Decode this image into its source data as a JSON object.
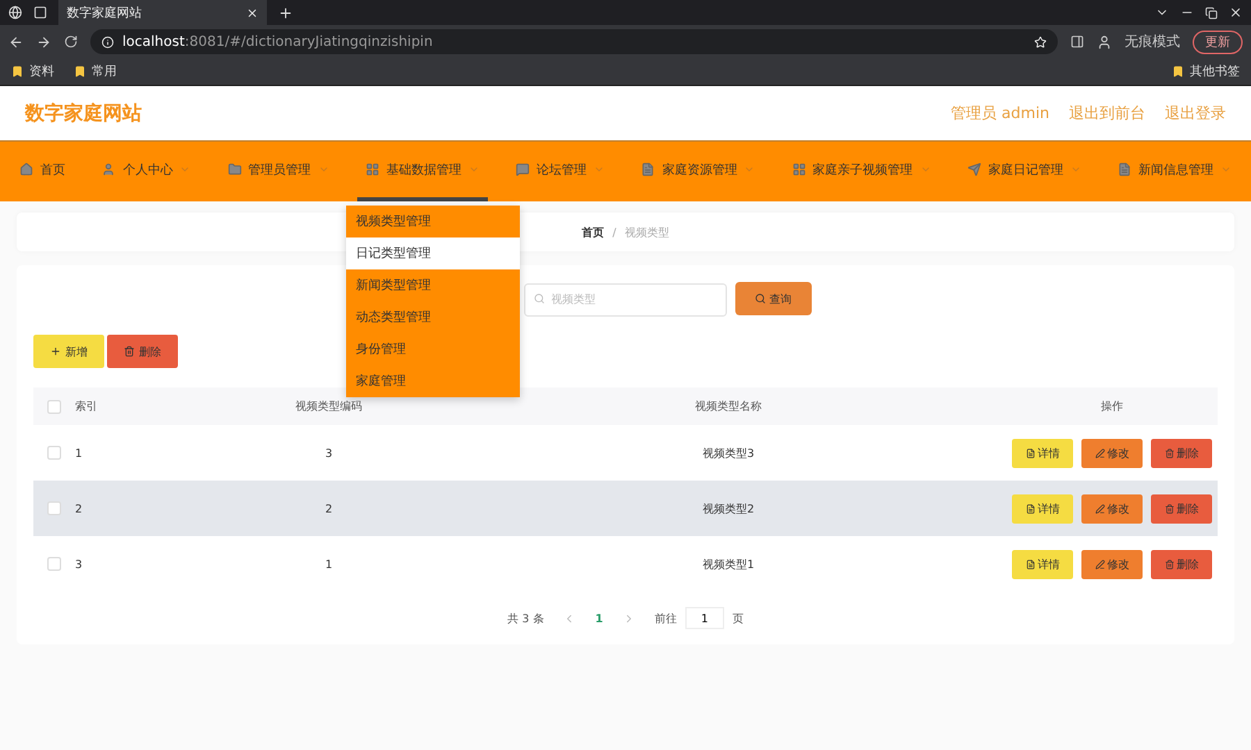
{
  "browser": {
    "tab_title": "数字家庭网站",
    "url_host": "localhost",
    "url_rest": ":8081/#/dictionaryJiatingqinzishipin",
    "profile": "无痕模式",
    "update": "更新",
    "bookmarks": [
      "资料",
      "常用"
    ],
    "other_bookmarks": "其他书签"
  },
  "header": {
    "site_title": "数字家庭网站",
    "links": [
      "管理员 admin",
      "退出到前台",
      "退出登录"
    ]
  },
  "nav": [
    {
      "label": "首页",
      "has_menu": false,
      "selected": false
    },
    {
      "label": "个人中心",
      "has_menu": true,
      "selected": false
    },
    {
      "label": "管理员管理",
      "has_menu": true,
      "selected": false
    },
    {
      "label": "基础数据管理",
      "has_menu": true,
      "selected": true
    },
    {
      "label": "论坛管理",
      "has_menu": true,
      "selected": false
    },
    {
      "label": "家庭资源管理",
      "has_menu": true,
      "selected": false
    },
    {
      "label": "家庭亲子视频管理",
      "has_menu": true,
      "selected": false
    },
    {
      "label": "家庭日记管理",
      "has_menu": true,
      "selected": false
    },
    {
      "label": "新闻信息管理",
      "has_menu": true,
      "selected": false
    }
  ],
  "dropdown": [
    {
      "label": "视频类型管理",
      "hovered": false
    },
    {
      "label": "日记类型管理",
      "hovered": true
    },
    {
      "label": "新闻类型管理",
      "hovered": false
    },
    {
      "label": "动态类型管理",
      "hovered": false
    },
    {
      "label": "身份管理",
      "hovered": false
    },
    {
      "label": "家庭管理",
      "hovered": false
    }
  ],
  "breadcrumb": [
    "首页",
    "/",
    "视频类型"
  ],
  "search": {
    "placeholder": "视频类型",
    "button": "查询"
  },
  "actions": [
    "新增",
    "删除"
  ],
  "table": {
    "select_all_checked": false,
    "columns": [
      "索引",
      "视频类型编码",
      "视频类型名称",
      "操作"
    ],
    "rows": [
      {
        "cells": [
          "1",
          "3",
          "视频类型3"
        ],
        "highlighted": false,
        "checked": false,
        "buttons": [
          "详情",
          "修改",
          "删除"
        ]
      },
      {
        "cells": [
          "2",
          "2",
          "视频类型2"
        ],
        "highlighted": true,
        "checked": false,
        "buttons": [
          "详情",
          "修改",
          "删除"
        ]
      },
      {
        "cells": [
          "3",
          "1",
          "视频类型1"
        ],
        "highlighted": false,
        "checked": false,
        "buttons": [
          "详情",
          "修改",
          "删除"
        ]
      }
    ]
  },
  "pagination": {
    "total": "共 3 条",
    "page": "1",
    "goto": "前往",
    "goto_value": "1",
    "page_unit": "页"
  }
}
